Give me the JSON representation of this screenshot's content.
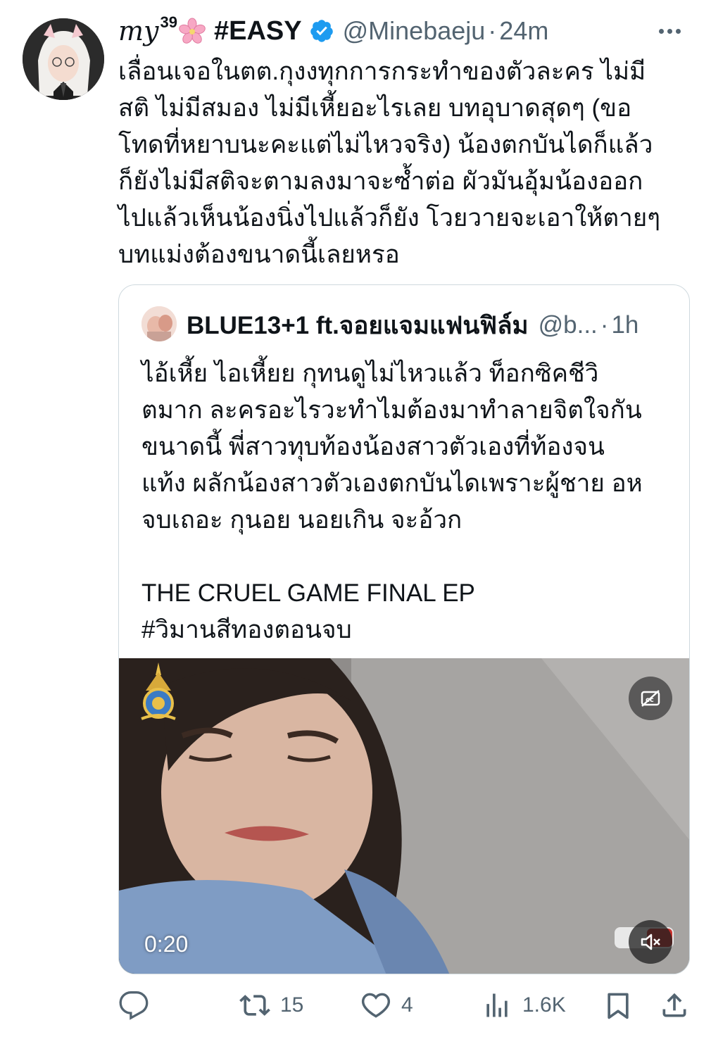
{
  "tweet": {
    "author": {
      "name_script": "my",
      "name_sup": "39",
      "name_flower": "cherry-blossom-emoji",
      "name_text": "#EASY",
      "verified": true,
      "handle": "@Minebaeju",
      "time": "24m"
    },
    "text_lines": [
      "เลื่อนเจอในตต.กุงงทุกการกระทำของตัวละคร ไม่มี",
      "สติ ไม่มีสมอง ไม่มีเหี้ยอะไรเลย บทอุบาดสุดๆ (ขอ",
      "โทดที่หยาบนะคะแต่ไม่ไหวจริง) น้องตกบันไดก็แล้ว",
      "ก็ยังไม่มีสติจะตามลงมาจะซ้ำต่อ ผัวมันอุ้มน้องออก",
      "ไปแล้วเห็นน้องนิ่งไปแล้วก็ยัง โวยวายจะเอาให้ตายๆ",
      "บทแม่งต้องขนาดนี้เลยหรอ"
    ],
    "quoted": {
      "name": "BLUE13+1 ft.จอยแจมแฟนฟิล์ม",
      "handle": "@b...",
      "time": "1h",
      "text_lines": [
        "ไอ้เหี้ย ไอเหี้ยย กุทนดูไม่ไหวแล้ว ท็อกซิคชีวิ",
        "ตมาก ละครอะไรวะทำไมต้องมาทำลายจิตใจกัน",
        "ขนาดนี้ พี่สาวทุบท้องน้องสาวตัวเองที่ท้องจน",
        "แท้ง ผลักน้องสาวตัวเองตกบันไดเพราะผู้ชาย อห",
        "จบเถอะ กุนอย นอยเกิน จะอ้วก",
        "",
        "THE CRUEL GAME FINAL EP",
        "#วิมานสีทองตอนจบ"
      ],
      "video": {
        "duration": "0:20",
        "cc_icon": "closed-captions-off-icon",
        "mute_icon": "speaker-muted-icon"
      }
    },
    "actions": {
      "reply": {
        "icon": "reply-icon",
        "count": ""
      },
      "retweet": {
        "icon": "retweet-icon",
        "count": "15"
      },
      "like": {
        "icon": "heart-icon",
        "count": "4"
      },
      "views": {
        "icon": "views-bar-chart-icon",
        "count": "1.6K"
      },
      "bookmark": {
        "icon": "bookmark-icon",
        "count": ""
      },
      "share": {
        "icon": "share-icon",
        "count": ""
      }
    },
    "colors": {
      "text": "#0f1419",
      "secondary": "#536471",
      "verified": "#1d9bf0",
      "border": "#cfd9de"
    }
  }
}
